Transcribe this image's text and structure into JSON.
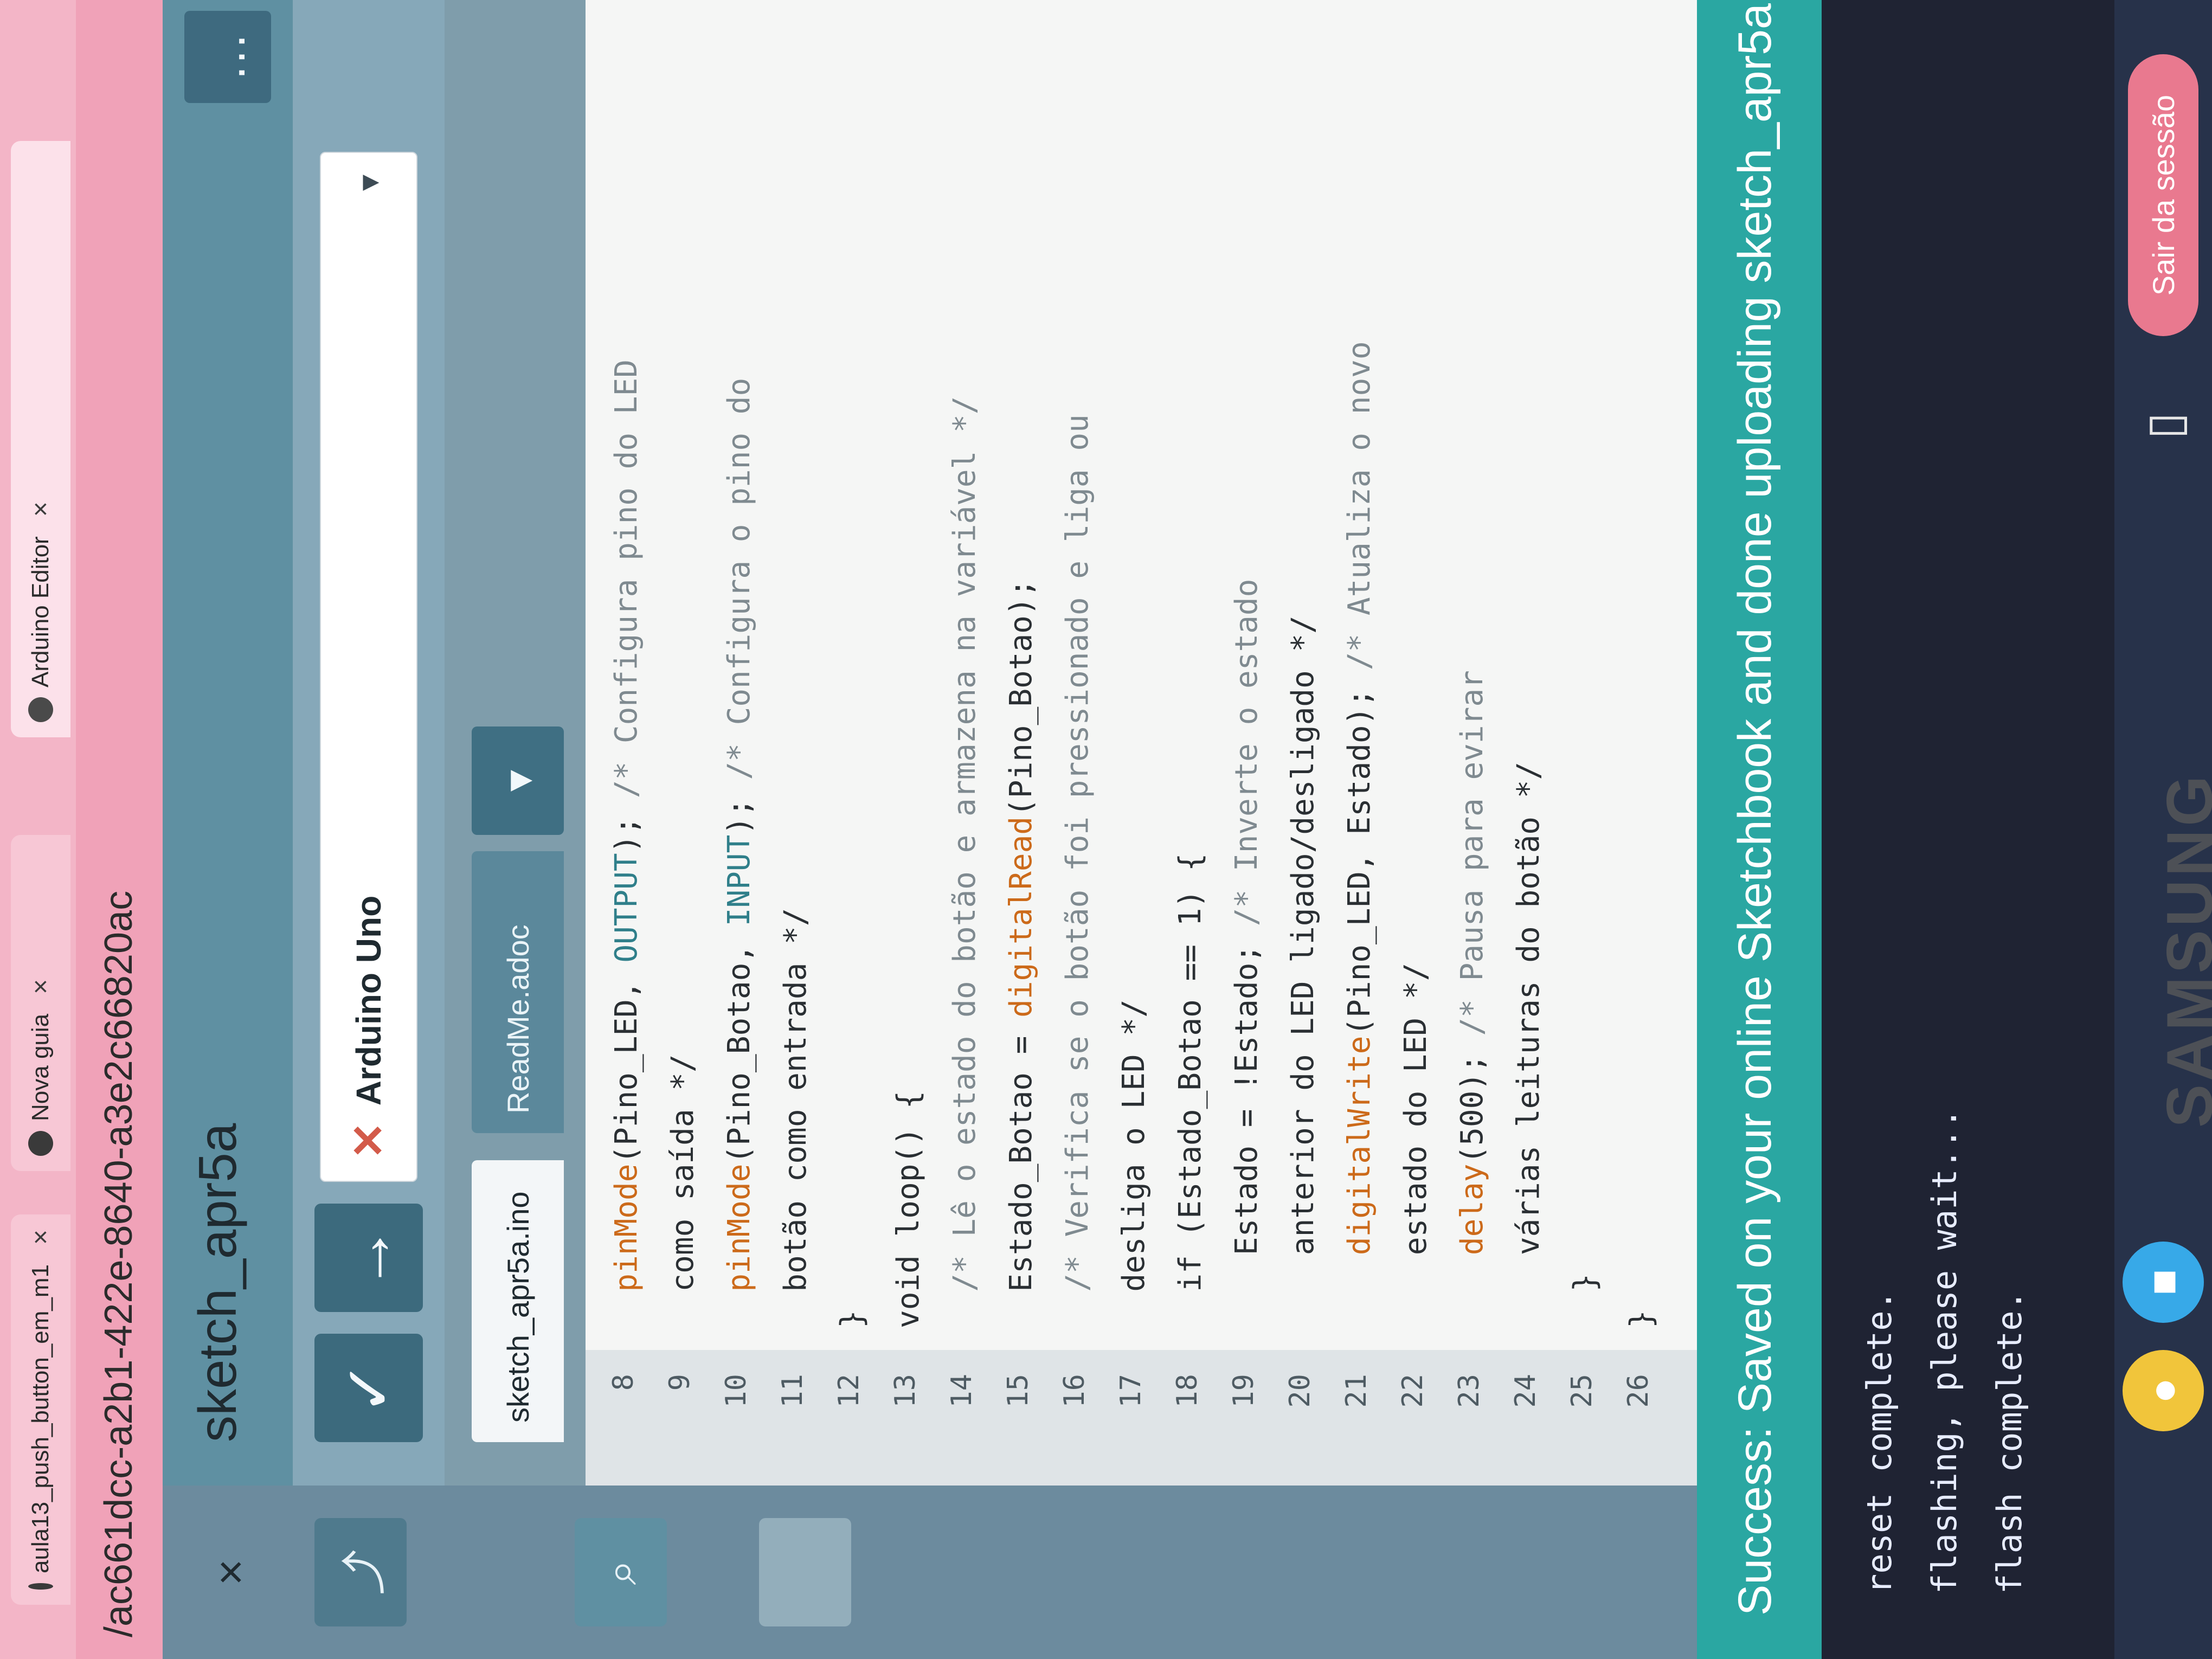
{
  "browser": {
    "tabs": [
      {
        "title": "aula13_push_button_em_m1",
        "close": "×"
      },
      {
        "title": "Nova guia",
        "close": "×"
      },
      {
        "title": "Arduino Editor",
        "close": "×"
      }
    ],
    "url": "/ac661dcc-a2b1-422e-8640-a3e2c66820ac"
  },
  "editor": {
    "sketch_title": "sketch_apr5a",
    "more_label": "…",
    "left_rail": {
      "close_label": "×",
      "open_icon": "open-icon",
      "search_icon": "search-icon"
    },
    "toolbar": {
      "verify_label": "✓",
      "upload_label": "→",
      "board": {
        "status_mark": "✕",
        "name": "Arduino Uno",
        "caret": "▾"
      }
    },
    "tabs": [
      {
        "label": "sketch_apr5a.ino"
      },
      {
        "label": "ReadMe.adoc"
      }
    ],
    "tabs_dropdown": "▾",
    "gutter": [
      "8",
      "9",
      "10",
      "11",
      "12",
      "13",
      "14",
      "15",
      "16",
      "17",
      "18",
      "19",
      "20",
      "21",
      "22",
      "23",
      "24",
      "25",
      "26"
    ],
    "code": [
      "  pinMode(Pino_LED, OUTPUT); /* Configura pino do LED",
      "  como saída */",
      "  pinMode(Pino_Botao, INPUT); /* Configura o pino do",
      "  botão como entrada */",
      "}",
      "void loop() {",
      "  /* Lê o estado do botão e armazena na variável */",
      "  Estado_Botao = digitalRead(Pino_Botao);",
      "  /* Verifica se o botão foi pressionado e liga ou",
      "  desliga o LED */",
      "  if (Estado_Botao == 1) {",
      "    Estado = !Estado; /* Inverte o estado",
      "    anterior do LED ligado/desligado */",
      "    digitalWrite(Pino_LED, Estado); /* Atualiza o novo",
      "    estado do LED */",
      "    delay(500); /* Pausa para evirar",
      "    várias leituras do botão */",
      "  }",
      "}"
    ]
  },
  "output": {
    "status": "Success: Saved on your online Sketchbook and done uploading sketch_apr5a",
    "lines": [
      "reset complete.",
      "flashing, please wait...",
      "flash complete."
    ]
  },
  "shelf": {
    "logout_label": "Sair da sessão"
  },
  "hardware": {
    "brand": "SAMSUNG"
  }
}
